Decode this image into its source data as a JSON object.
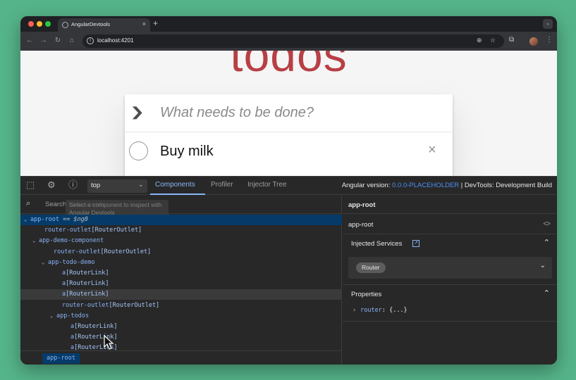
{
  "browser": {
    "tab_title": "AngularDevtools",
    "tab_close": "×",
    "new_tab": "+",
    "tab_search": "⌄",
    "url": "localhost:4201"
  },
  "app": {
    "title": "todos",
    "new_todo_placeholder": "What needs to be done?",
    "toggle_all": "❯",
    "todos": [
      {
        "label": "Buy milk",
        "completed": false
      }
    ],
    "destroy": "×"
  },
  "devtools": {
    "frame": "top",
    "tabs": [
      "Components",
      "Profiler",
      "Injector Tree"
    ],
    "active_tab": "Components",
    "version_prefix": "Angular version: ",
    "version": "0.0.0-PLACEHOLDER",
    "build": " | DevTools: Development Build",
    "search_placeholder": "Search components",
    "tooltip": "Select a component to inspect with Angular Devtools",
    "tree": [
      {
        "twisty": "⌄",
        "name": "app-root",
        "suffix": " == $ng0",
        "selected": true
      },
      {
        "twisty": "",
        "name": "router-outlet",
        "directive": "[RouterOutlet]"
      },
      {
        "twisty": "⌄",
        "name": "app-demo-component",
        "directive": ""
      },
      {
        "twisty": "",
        "name": "router-outlet",
        "directive": "[RouterOutlet]"
      },
      {
        "twisty": "⌄",
        "name": "app-todo-demo",
        "directive": ""
      },
      {
        "twisty": "",
        "name": "a",
        "directive": "[RouterLink]"
      },
      {
        "twisty": "",
        "name": "a",
        "directive": "[RouterLink]"
      },
      {
        "twisty": "",
        "name": "a",
        "directive": "[RouterLink]",
        "hover": true
      },
      {
        "twisty": "",
        "name": "router-outlet",
        "directive": "[RouterOutlet]"
      },
      {
        "twisty": "⌄",
        "name": "app-todos",
        "directive": ""
      },
      {
        "twisty": "",
        "name": "a",
        "directive": "[RouterLink]"
      },
      {
        "twisty": "",
        "name": "a",
        "directive": "[RouterLink]"
      },
      {
        "twisty": "",
        "name": "a",
        "directive": "[RouterLink]"
      }
    ],
    "breadcrumb": "app-root",
    "details": {
      "header": "app-root",
      "component_name": "app-root",
      "injected_services_title": "Injected Services",
      "services": [
        "Router"
      ],
      "properties_title": "Properties",
      "properties": [
        {
          "key": "router",
          "value": ": {...}"
        }
      ]
    }
  },
  "colors": {
    "background": "#55b48a",
    "title_red": "#b83f45",
    "devtools_accent": "#8ab4f8",
    "version_link": "#4f8ff7",
    "selected_row": "#063b69"
  }
}
